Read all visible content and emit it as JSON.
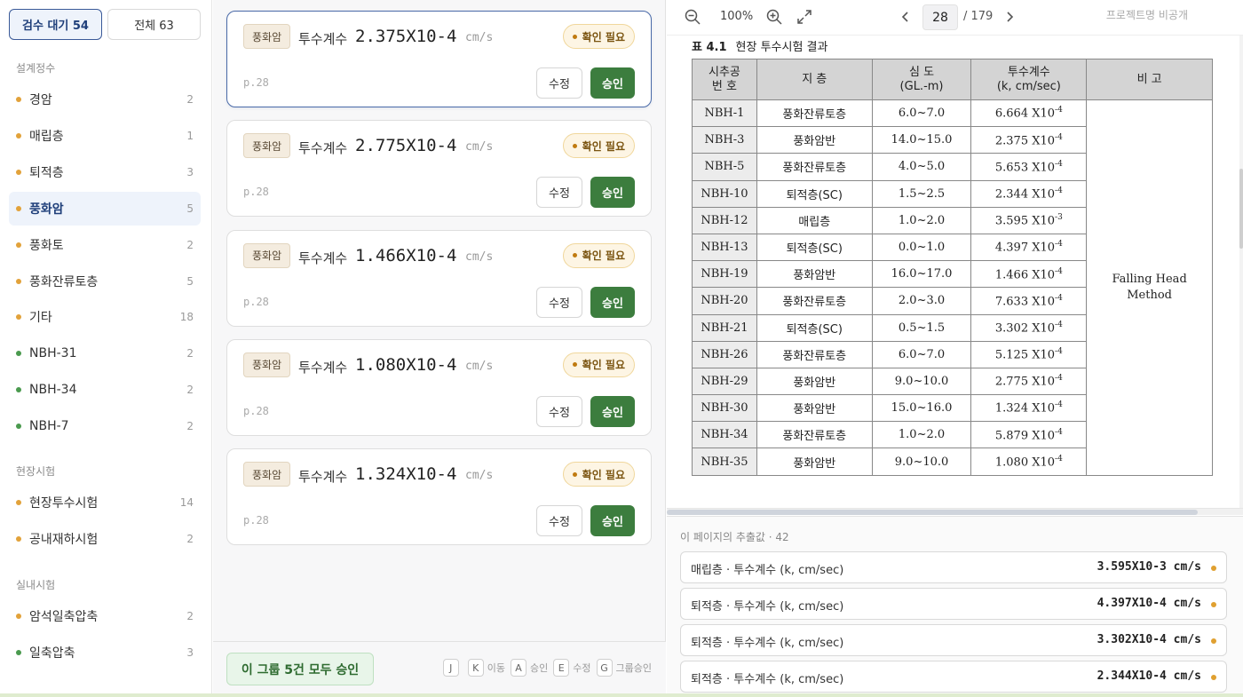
{
  "filters": {
    "pending_label": "검수 대기 54",
    "all_label": "전체 63"
  },
  "sections": [
    {
      "label": "설계정수",
      "items": [
        {
          "label": "경암",
          "count": "2",
          "color": "#e2a23a"
        },
        {
          "label": "매립층",
          "count": "1",
          "color": "#e2a23a"
        },
        {
          "label": "퇴적층",
          "count": "3",
          "color": "#e2a23a"
        },
        {
          "label": "풍화암",
          "count": "5",
          "color": "#e2a23a"
        },
        {
          "label": "풍화토",
          "count": "2",
          "color": "#e2a23a"
        },
        {
          "label": "풍화잔류토층",
          "count": "5",
          "color": "#e2a23a"
        },
        {
          "label": "기타",
          "count": "18",
          "color": "#e2a23a"
        },
        {
          "label": "NBH-31",
          "count": "2",
          "color": "#4a9a4e"
        },
        {
          "label": "NBH-34",
          "count": "2",
          "color": "#4a9a4e"
        },
        {
          "label": "NBH-7",
          "count": "2",
          "color": "#4a9a4e"
        }
      ]
    },
    {
      "label": "현장시험",
      "items": [
        {
          "label": "현장투수시험",
          "count": "14",
          "color": "#e2a23a"
        },
        {
          "label": "공내재하시험",
          "count": "2",
          "color": "#e2a23a"
        }
      ]
    },
    {
      "label": "실내시험",
      "items": [
        {
          "label": "암석일축압축",
          "count": "2",
          "color": "#e2a23a"
        },
        {
          "label": "일축압축",
          "count": "3",
          "color": "#4a9a4e"
        }
      ]
    }
  ],
  "cards": [
    {
      "tag": "풍화암",
      "param": "투수계수",
      "value": "2.375X10-4",
      "unit": "cm/s",
      "badge": "확인 필요",
      "page": "p.28",
      "edit": "수정",
      "approve": "승인"
    },
    {
      "tag": "풍화암",
      "param": "투수계수",
      "value": "2.775X10-4",
      "unit": "cm/s",
      "badge": "확인 필요",
      "page": "p.28",
      "edit": "수정",
      "approve": "승인"
    },
    {
      "tag": "풍화암",
      "param": "투수계수",
      "value": "1.466X10-4",
      "unit": "cm/s",
      "badge": "확인 필요",
      "page": "p.28",
      "edit": "수정",
      "approve": "승인"
    },
    {
      "tag": "풍화암",
      "param": "투수계수",
      "value": "1.080X10-4",
      "unit": "cm/s",
      "badge": "확인 필요",
      "page": "p.28",
      "edit": "수정",
      "approve": "승인"
    },
    {
      "tag": "풍화암",
      "param": "투수계수",
      "value": "1.324X10-4",
      "unit": "cm/s",
      "badge": "확인 필요",
      "page": "p.28",
      "edit": "수정",
      "approve": "승인"
    }
  ],
  "footer": {
    "approve_all": "이 그룹 5건 모두 승인",
    "shortcuts": [
      {
        "keys": [
          "J",
          "K"
        ],
        "label": "이동"
      },
      {
        "keys": [
          "A"
        ],
        "label": "승인"
      },
      {
        "keys": [
          "E"
        ],
        "label": "수정"
      },
      {
        "keys": [
          "G"
        ],
        "label": "그룹승인"
      }
    ]
  },
  "viewer": {
    "zoom": "100%",
    "page": "28",
    "total": "/ 179",
    "project": "프로젝트명 비공개",
    "doc_title_num": "표 4.1",
    "doc_title": "현장 투수시험 결과",
    "table_headers": [
      "시추공\n번  호",
      "지  층",
      "심  도\n(GL.-m)",
      "투수계수\n(k, cm/sec)",
      "비  고"
    ],
    "table_rows": [
      [
        "NBH-1",
        "풍화잔류토층",
        "6.0~7.0",
        "6.664",
        "-4"
      ],
      [
        "NBH-3",
        "풍화암반",
        "14.0~15.0",
        "2.375",
        "-4"
      ],
      [
        "NBH-5",
        "풍화잔류토층",
        "4.0~5.0",
        "5.653",
        "-4"
      ],
      [
        "NBH-10",
        "퇴적층(SC)",
        "1.5~2.5",
        "2.344",
        "-4"
      ],
      [
        "NBH-12",
        "매립층",
        "1.0~2.0",
        "3.595",
        "-3"
      ],
      [
        "NBH-13",
        "퇴적층(SC)",
        "0.0~1.0",
        "4.397",
        "-4"
      ],
      [
        "NBH-19",
        "풍화암반",
        "16.0~17.0",
        "1.466",
        "-4"
      ],
      [
        "NBH-20",
        "풍화잔류토층",
        "2.0~3.0",
        "7.633",
        "-4"
      ],
      [
        "NBH-21",
        "퇴적층(SC)",
        "0.5~1.5",
        "3.302",
        "-4"
      ],
      [
        "NBH-26",
        "풍화잔류토층",
        "6.0~7.0",
        "5.125",
        "-4"
      ],
      [
        "NBH-29",
        "풍화암반",
        "9.0~10.0",
        "2.775",
        "-4"
      ],
      [
        "NBH-30",
        "풍화암반",
        "15.0~16.0",
        "1.324",
        "-4"
      ],
      [
        "NBH-34",
        "풍화잔류토층",
        "1.0~2.0",
        "5.879",
        "-4"
      ],
      [
        "NBH-35",
        "풍화암반",
        "9.0~10.0",
        "1.080",
        "-4"
      ]
    ],
    "remark_line1": "Falling Head",
    "remark_line2": "Method",
    "times_ten": "X10"
  },
  "extracted": {
    "header": "이 페이지의 추출값 · 42",
    "rows": [
      {
        "label": "매립층 · 투수계수 (k, cm/sec)",
        "value": "3.595X10-3 cm/s"
      },
      {
        "label": "퇴적층 · 투수계수 (k, cm/sec)",
        "value": "4.397X10-4 cm/s"
      },
      {
        "label": "퇴적층 · 투수계수 (k, cm/sec)",
        "value": "3.302X10-4 cm/s"
      },
      {
        "label": "퇴적층 · 투수계수 (k, cm/sec)",
        "value": "2.344X10-4 cm/s"
      }
    ]
  }
}
